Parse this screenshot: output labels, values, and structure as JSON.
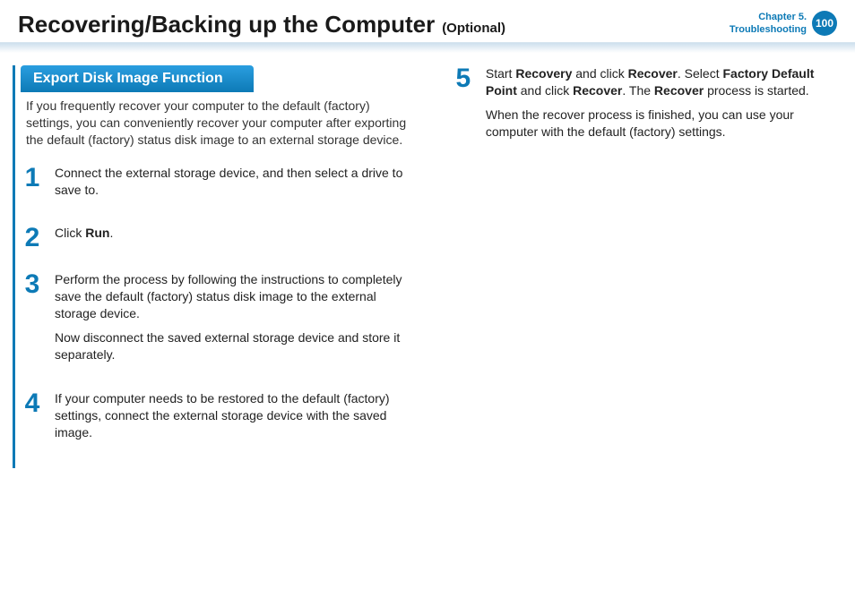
{
  "header": {
    "title": "Recovering/Backing up the Computer",
    "title_suffix": "(Optional)",
    "chapter_line1": "Chapter 5.",
    "chapter_line2": "Troubleshooting",
    "page_number": "100"
  },
  "section": {
    "heading": "Export Disk Image Function",
    "intro": "If you frequently recover your computer to the default (factory) settings, you can conveniently recover your computer after exporting the default (factory) status disk image to an external storage device."
  },
  "steps": [
    {
      "num": "1",
      "para1_pre": "Connect the external storage device, and then select a drive to save to."
    },
    {
      "num": "2",
      "para1_pre": "Click ",
      "para1_b1": "Run",
      "para1_post": "."
    },
    {
      "num": "3",
      "para1_pre": "Perform the process by following the instructions to completely save the default (factory) status disk image to the external storage device.",
      "para2": "Now disconnect the saved external storage device and store it separately."
    },
    {
      "num": "4",
      "para1_pre": "If your computer needs to be restored to the default (factory) settings, connect the external storage device with the saved image."
    },
    {
      "num": "5",
      "para1_pre": "Start ",
      "para1_b1": "Recovery",
      "para1_mid1": " and click ",
      "para1_b2": "Recover",
      "para1_mid2": ". Select ",
      "para1_b3": "Factory Default Point",
      "para1_mid3": " and click ",
      "para1_b4": "Recover",
      "para1_mid4": ". The ",
      "para1_b5": "Recover",
      "para1_post": " process is started.",
      "para2": "When the recover process is finished, you can use your computer with the default (factory) settings."
    }
  ]
}
